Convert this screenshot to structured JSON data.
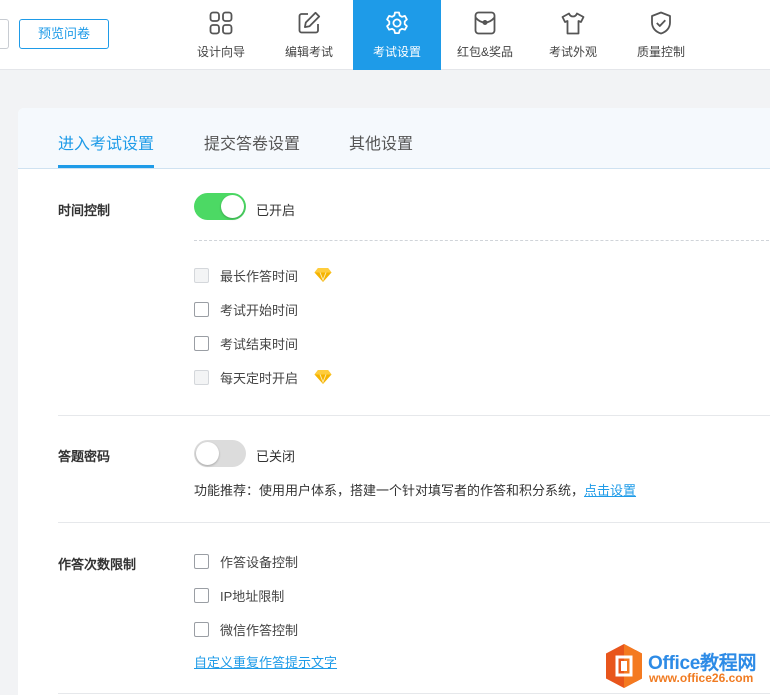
{
  "toolbar": {
    "preview_label": "预览问卷"
  },
  "nav": {
    "items": [
      {
        "label": "设计向导",
        "icon": "grid-icon",
        "active": false
      },
      {
        "label": "编辑考试",
        "icon": "edit-icon",
        "active": false
      },
      {
        "label": "考试设置",
        "icon": "gear-icon",
        "active": true
      },
      {
        "label": "红包&奖品",
        "icon": "red-packet-icon",
        "active": false
      },
      {
        "label": "考试外观",
        "icon": "tshirt-icon",
        "active": false
      },
      {
        "label": "质量控制",
        "icon": "shield-check-icon",
        "active": false
      }
    ],
    "accent": "#1e9be8"
  },
  "tabs": [
    {
      "label": "进入考试设置",
      "active": true
    },
    {
      "label": "提交答卷设置",
      "active": false
    },
    {
      "label": "其他设置",
      "active": false
    }
  ],
  "time_control": {
    "label": "时间控制",
    "toggle_on": true,
    "status": "已开启",
    "options": [
      {
        "label": "最长作答时间",
        "checked": false,
        "disabled": true,
        "premium": true
      },
      {
        "label": "考试开始时间",
        "checked": false,
        "disabled": false,
        "premium": false
      },
      {
        "label": "考试结束时间",
        "checked": false,
        "disabled": false,
        "premium": false
      },
      {
        "label": "每天定时开启",
        "checked": false,
        "disabled": true,
        "premium": true
      }
    ]
  },
  "password": {
    "label": "答题密码",
    "toggle_on": false,
    "status": "已关闭",
    "note": "功能推荐：使用用户体系，搭建一个针对填写者的作答和积分系统，",
    "note_link": "点击设置"
  },
  "attempt_limit": {
    "label": "作答次数限制",
    "options": [
      {
        "label": "作答设备控制",
        "checked": false
      },
      {
        "label": "IP地址限制",
        "checked": false
      },
      {
        "label": "微信作答控制",
        "checked": false
      }
    ],
    "custom_link": "自定义重复作答提示文字"
  },
  "watermark": {
    "title": "Office教程网",
    "url": "www.office26.com"
  },
  "colors": {
    "accent": "#1e9be8",
    "toggle_on": "#4cd964",
    "toggle_off": "#dcdcdc",
    "premium_gem": "#f5b400"
  }
}
